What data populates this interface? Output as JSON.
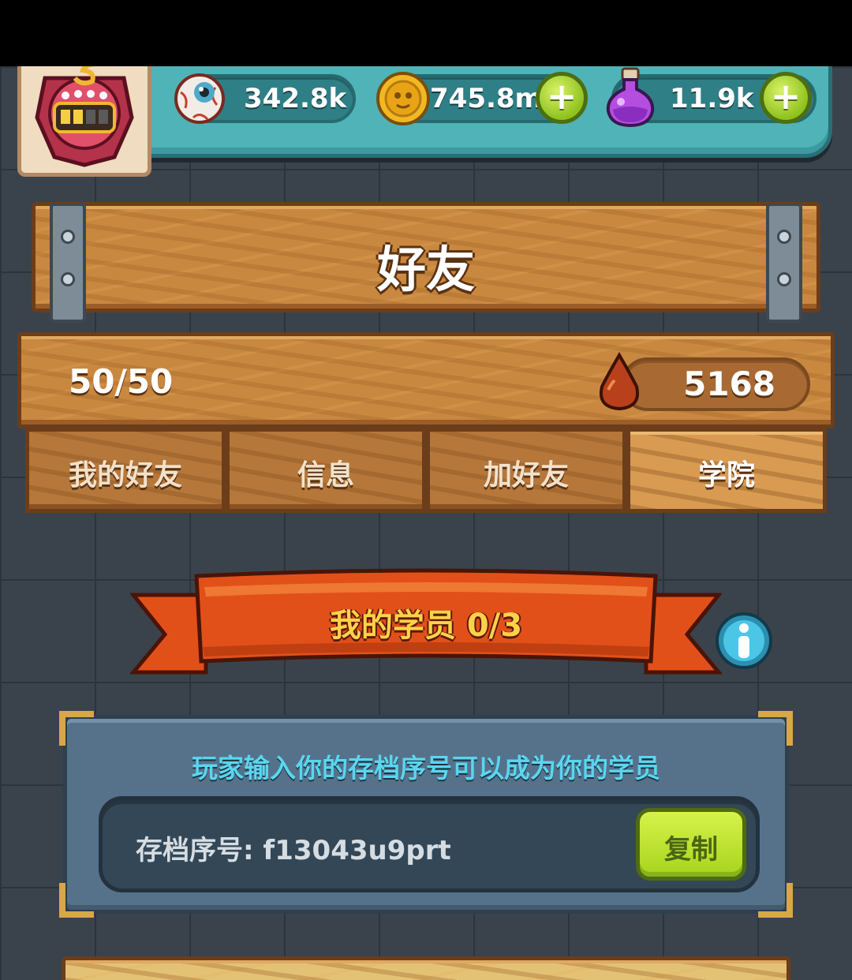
{
  "resources": {
    "eyeballs": "342.8k",
    "coins": "745.8m",
    "potions": "11.9k",
    "plus_symbol": "+"
  },
  "header": {
    "title": "好友"
  },
  "stats": {
    "friend_count": "50/50",
    "blood": "5168"
  },
  "tabs": [
    {
      "label": "我的好友",
      "active": false
    },
    {
      "label": "信息",
      "active": false
    },
    {
      "label": "加好友",
      "active": false
    },
    {
      "label": "学院",
      "active": true
    }
  ],
  "academy": {
    "ribbon_title": "我的学员 0/3",
    "hint": "玩家输入你的存档序号可以成为你的学员",
    "save_code": "存档序号: f13043u9prt",
    "copy_label": "复制"
  },
  "colors": {
    "resource_bar": "#4fb3b8",
    "wood": "#c98840",
    "ribbon": "#e0561c",
    "panel": "#56728a",
    "hint_text": "#5ad6f0",
    "copy_button": "#c4e63a"
  },
  "icons": [
    "badge-icon",
    "eyeball-icon",
    "coin-icon",
    "potion-icon",
    "plus-icon",
    "blood-drop-icon",
    "info-icon"
  ]
}
